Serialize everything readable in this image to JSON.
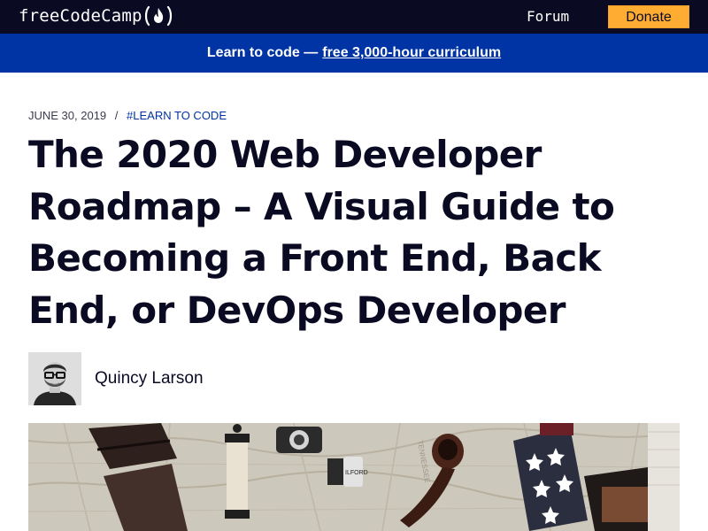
{
  "nav": {
    "logo_text": "freeCodeCamp",
    "logo_icon": "flame-icon",
    "forum_label": "Forum",
    "donate_label": "Donate"
  },
  "banner": {
    "lead": "Learn to code —",
    "link_text": "free 3,000-hour curriculum"
  },
  "article": {
    "date": "JUNE 30, 2019",
    "separator": "/",
    "tag": "#LEARN TO CODE",
    "title": "The 2020 Web Developer Roadmap – A Visual Guide to Becoming a Front End, Back End, or DevOps Developer",
    "author": {
      "name": "Quincy Larson",
      "avatar_icon": "author-avatar-photo"
    },
    "feature_image": "travel-flatlay-map-photo"
  },
  "colors": {
    "nav_bg": "#0a0a23",
    "banner_bg": "#0033a3",
    "donate_bg": "#feac32",
    "title_text": "#0a0a23",
    "tag_text": "#0033a3"
  }
}
